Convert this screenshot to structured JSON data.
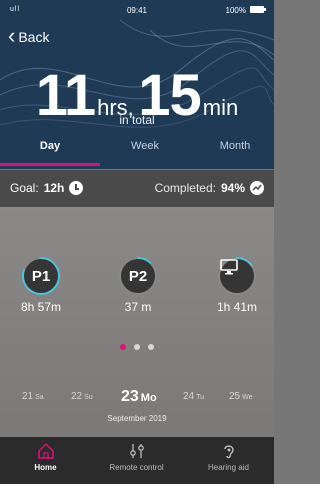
{
  "status": {
    "signal": "ull",
    "time": "09:41",
    "battery": "100%"
  },
  "header": {
    "back_label": "Back",
    "hours_value": "11",
    "hours_unit": "hrs,",
    "minutes_value": "15",
    "minutes_unit": "min",
    "subtitle": "in total",
    "tabs": [
      "Day",
      "Week",
      "Month"
    ],
    "active_tab": "Day"
  },
  "goal_bar": {
    "goal_label": "Goal:",
    "goal_value": "12h",
    "completed_label": "Completed:",
    "completed_value": "94%"
  },
  "devices": [
    {
      "label": "P1",
      "duration": "8h 57m",
      "progress": 0.8
    },
    {
      "label": "P2",
      "duration": "37 m",
      "progress": 0.12
    },
    {
      "icon": "monitor-icon",
      "duration": "1h 41m",
      "progress": 0.15
    }
  ],
  "pager": {
    "pages": 3,
    "active_index": 0
  },
  "dates": [
    {
      "day": "21",
      "weekday": "Sa"
    },
    {
      "day": "22",
      "weekday": "Su"
    },
    {
      "day": "23",
      "weekday": "Mo",
      "selected": true
    },
    {
      "day": "24",
      "weekday": "Tu"
    },
    {
      "day": "25",
      "weekday": "We"
    }
  ],
  "month_label": "September 2019",
  "nav": [
    {
      "label": "Home",
      "icon": "home-icon",
      "active": true
    },
    {
      "label": "Remote control",
      "icon": "sliders-icon"
    },
    {
      "label": "Hearing aid",
      "icon": "ear-icon"
    }
  ],
  "colors": {
    "accent": "#e0107a",
    "header_bg": "#1f3a55",
    "ring": "#48c4e0"
  }
}
